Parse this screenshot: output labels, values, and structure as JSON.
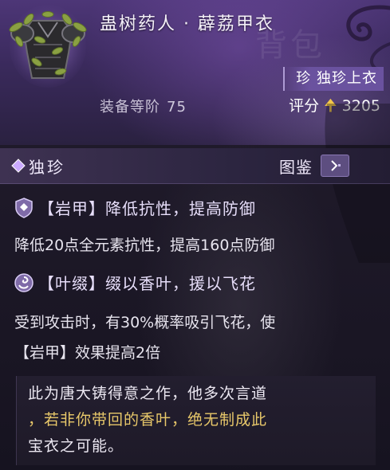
{
  "item": {
    "icon": "herb-armor-icon",
    "name": "蛊树药人 · 薜荔甲衣",
    "rarity_tag": "珍 独珍上衣",
    "equip_rank_label": "装备等阶",
    "equip_rank_value": "75",
    "score_label": "评分",
    "score_value": "3205"
  },
  "header_watermark": "背包",
  "rarity_bar": {
    "gem_glyph": "珍",
    "label": "独珍",
    "atlas_label": "图鉴"
  },
  "effects": [
    {
      "icon": "shield-tag-icon",
      "title": "【岩甲】降低抗性，提高防御",
      "desc": "降低20点全元素抗性，提高160点防御"
    },
    {
      "icon": "swirl-tag-icon",
      "title": "【叶缀】缀以香叶，援以飞花",
      "desc_line1": "受到攻击时，有30%概率吸引飞花，使",
      "desc_line2": "【岩甲】效果提高2倍"
    }
  ],
  "flavor": {
    "part1": "此为唐大铸得意之作，他多次言道",
    "part2": "，若非你带回的香叶，绝无制成此",
    "part3": "宝衣之可能。"
  },
  "colors": {
    "header_purple": "#4d3677",
    "score_arrow": "#f3c74a",
    "flavor_gold": "#e8c86a"
  }
}
